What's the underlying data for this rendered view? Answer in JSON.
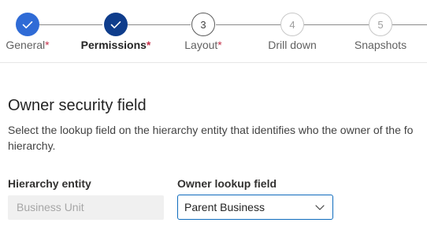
{
  "steps": [
    {
      "number": "",
      "label": "General",
      "required_mark": "*",
      "state": "completed"
    },
    {
      "number": "",
      "label": "Permissions",
      "required_mark": "*",
      "state": "active"
    },
    {
      "number": "3",
      "label": "Layout",
      "required_mark": "*",
      "state": "next"
    },
    {
      "number": "4",
      "label": "Drill down",
      "required_mark": "",
      "state": "upcoming"
    },
    {
      "number": "5",
      "label": "Snapshots",
      "required_mark": "",
      "state": "upcoming"
    }
  ],
  "section": {
    "title": "Owner security field",
    "description": "Select the lookup field on the hierarchy entity that identifies who the owner of the fo hierarchy."
  },
  "fields": {
    "hierarchy_entity": {
      "label": "Hierarchy entity",
      "value": "Business Unit"
    },
    "owner_lookup": {
      "label": "Owner lookup field",
      "value": "Parent Business"
    }
  },
  "icons": {
    "completed_step": "checkmark-icon",
    "dropdown": "chevron-down-icon"
  },
  "colors": {
    "step_completed": "#2f6bd6",
    "step_active": "#0f3d8c",
    "required": "#c4314b",
    "focus_border": "#0f6cbd"
  }
}
